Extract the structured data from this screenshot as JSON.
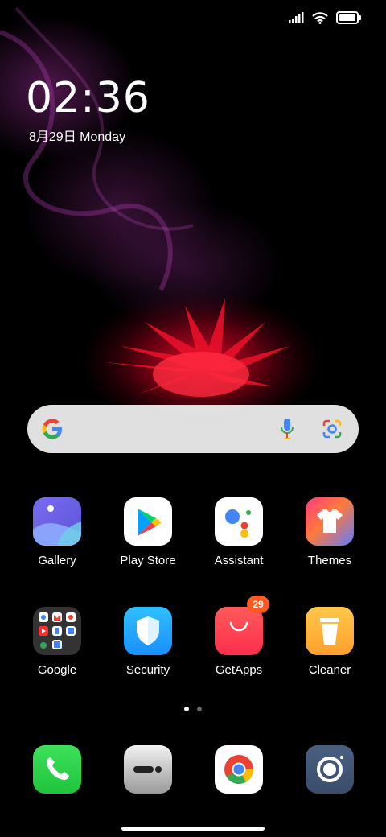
{
  "status_bar": {
    "signal": "signal-icon",
    "wifi": "wifi-icon",
    "battery": "battery-icon"
  },
  "lock": {
    "time": "02:36",
    "date": "8月29日 Monday"
  },
  "search": {
    "logo": "google-g-icon",
    "mic": "mic-icon",
    "lens": "lens-icon"
  },
  "apps_row1": [
    {
      "label": "Gallery",
      "icon": "gallery-icon"
    },
    {
      "label": "Play Store",
      "icon": "play-store-icon"
    },
    {
      "label": "Assistant",
      "icon": "assistant-icon"
    },
    {
      "label": "Themes",
      "icon": "themes-icon"
    }
  ],
  "apps_row2": [
    {
      "label": "Google",
      "icon": "google-folder-icon"
    },
    {
      "label": "Security",
      "icon": "security-icon"
    },
    {
      "label": "GetApps",
      "icon": "getapps-icon",
      "badge": "29"
    },
    {
      "label": "Cleaner",
      "icon": "cleaner-icon"
    }
  ],
  "dock": [
    {
      "icon": "phone-icon"
    },
    {
      "icon": "messaging-icon"
    },
    {
      "icon": "chrome-icon"
    },
    {
      "icon": "camera-icon"
    }
  ],
  "pager": {
    "pages": 2,
    "current": 1
  }
}
